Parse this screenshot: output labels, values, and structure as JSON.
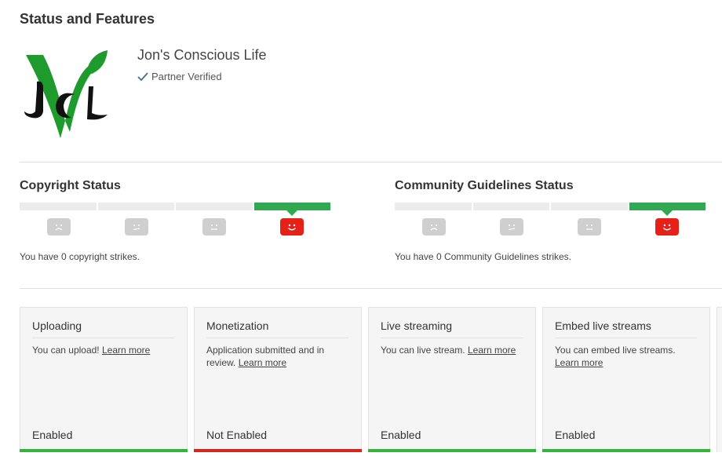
{
  "page": {
    "title": "Status and Features"
  },
  "channel": {
    "name": "Jon's Conscious Life",
    "badge": "Partner Verified",
    "logo_letters": "JCL"
  },
  "copyright": {
    "title": "Copyright Status",
    "active_index": 3,
    "text": "You have 0 copyright strikes."
  },
  "community": {
    "title": "Community Guidelines Status",
    "active_index": 3,
    "text": "You have 0 Community Guidelines strikes."
  },
  "cards": [
    {
      "title": "Uploading",
      "desc": "You can upload!",
      "link": "Learn more",
      "status": "Enabled",
      "status_color": "#33b53a"
    },
    {
      "title": "Monetization",
      "desc": "Application submitted and in review.",
      "link": "Learn more",
      "status": "Not Enabled",
      "status_color": "#d9261c"
    },
    {
      "title": "Live streaming",
      "desc": "You can live stream.",
      "link": "Learn more",
      "status": "Enabled",
      "status_color": "#33b53a"
    },
    {
      "title": "Embed live streams",
      "desc": "You can embed live streams.",
      "link": "Learn more",
      "status": "Enabled",
      "status_color": "#33b53a"
    }
  ],
  "colors": {
    "good": "#33a852",
    "face_active": "#e62117",
    "face_inactive": "#cfcfcf"
  },
  "icons": {
    "verified": "check-icon",
    "faces": [
      "sad-face-icon",
      "slight-frown-icon",
      "neutral-face-icon",
      "happy-face-icon"
    ]
  }
}
